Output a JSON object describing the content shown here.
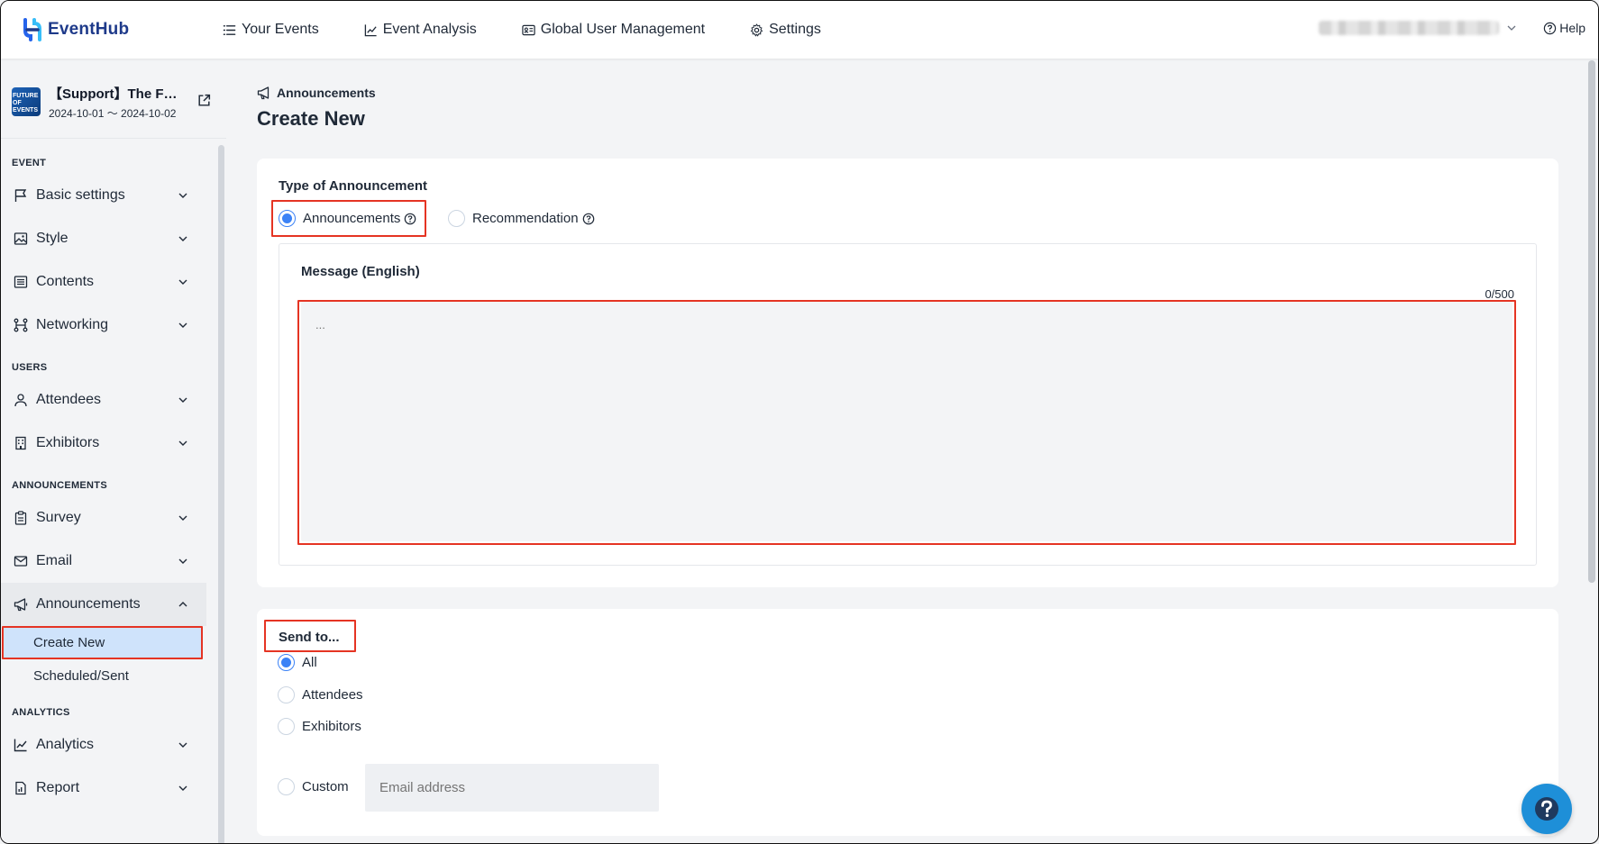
{
  "app": {
    "name": "EventHub"
  },
  "nav": {
    "your_events": "Your Events",
    "event_analysis": "Event Analysis",
    "global_user_management": "Global User Management",
    "settings": "Settings",
    "help": "Help"
  },
  "event": {
    "title": "【Support】The F…",
    "dates": "2024-10-01 〜 2024-10-02",
    "thumb_text": "FUTURE OF EVENTS"
  },
  "sidebar": {
    "section_event": "EVENT",
    "basic_settings": "Basic settings",
    "style": "Style",
    "contents": "Contents",
    "networking": "Networking",
    "section_users": "USERS",
    "attendees": "Attendees",
    "exhibitors": "Exhibitors",
    "section_announcements": "ANNOUNCEMENTS",
    "survey": "Survey",
    "email": "Email",
    "announcements": "Announcements",
    "create_new": "Create New",
    "scheduled_sent": "Scheduled/Sent",
    "section_analytics": "ANALYTICS",
    "analytics": "Analytics",
    "report": "Report"
  },
  "page": {
    "breadcrumb": "Announcements",
    "title": "Create New"
  },
  "form": {
    "type_label": "Type of Announcement",
    "type_announcements": "Announcements",
    "type_recommendation": "Recommendation",
    "message_label": "Message (English)",
    "counter": "0/500",
    "message_placeholder": "...",
    "send_to_label": "Send to...",
    "send_all": "All",
    "send_attendees": "Attendees",
    "send_exhibitors": "Exhibitors",
    "send_custom": "Custom",
    "email_placeholder": "Email address"
  },
  "colors": {
    "accent": "#3b82f6",
    "highlight": "#e53423",
    "active_item": "#cfe3fb",
    "fab": "#1e8fd8"
  }
}
